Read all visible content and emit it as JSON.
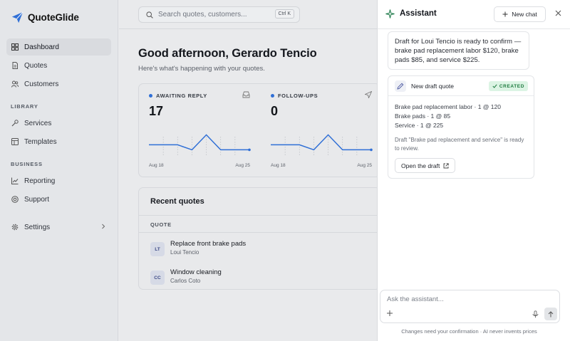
{
  "app": {
    "name": "QuoteGlide"
  },
  "sidebar": {
    "nav": [
      {
        "label": "Dashboard",
        "icon": "dashboard-icon",
        "active": true
      },
      {
        "label": "Quotes",
        "icon": "document-icon"
      },
      {
        "label": "Customers",
        "icon": "users-icon"
      }
    ],
    "library_label": "LIBRARY",
    "library": [
      {
        "label": "Services",
        "icon": "wrench-icon"
      },
      {
        "label": "Templates",
        "icon": "template-icon"
      }
    ],
    "business_label": "BUSINESS",
    "business": [
      {
        "label": "Reporting",
        "icon": "chart-icon"
      },
      {
        "label": "Support",
        "icon": "lifebuoy-icon"
      }
    ],
    "settings_label": "Settings"
  },
  "search": {
    "placeholder": "Search quotes, customers...",
    "shortcut": "Ctrl K"
  },
  "main": {
    "greeting": "Good afternoon, Gerardo Tencio",
    "subtitle": "Here's what's happening with your quotes.",
    "stats": [
      {
        "label": "AWAITING REPLY",
        "value": "17",
        "icon": "inbox-icon",
        "x_start": "Aug 18",
        "x_end": "Aug 25",
        "trend": [
          0.45,
          0.45,
          0.45,
          0.2,
          0.95,
          0.2,
          0.2,
          0.2
        ]
      },
      {
        "label": "FOLLOW-UPS",
        "value": "0",
        "icon": "send-icon",
        "x_start": "Aug 18",
        "x_end": "Aug 25",
        "trend": [
          0.45,
          0.45,
          0.45,
          0.2,
          0.95,
          0.2,
          0.2,
          0.2
        ]
      }
    ],
    "recent": {
      "title": "Recent quotes",
      "column": "QUOTE",
      "rows": [
        {
          "initials": "LT",
          "title": "Replace front brake pads",
          "customer": "Loui Tencio"
        },
        {
          "initials": "CC",
          "title": "Window cleaning",
          "customer": "Carlos Coto"
        }
      ]
    }
  },
  "assistant": {
    "title": "Assistant",
    "new_chat": "New chat",
    "message": "Draft for Loui Tencio is ready to confirm — brake pad replacement labor $120, brake pads $85, and service $225.",
    "tool": {
      "title": "New draft quote",
      "badge": "CREATED",
      "items": [
        "Brake pad replacement labor · 1 @ 120",
        "Brake pads · 1 @ 85",
        "Service · 1 @ 225"
      ],
      "note": "Draft \"Brake pad replacement and service\" is ready to review.",
      "open_label": "Open the draft"
    },
    "composer_placeholder": "Ask the assistant...",
    "footnote": "Changes need your confirmation · AI never invents prices"
  },
  "colors": {
    "accent": "#2f6fd6",
    "badge_bg": "#dcf4e4",
    "badge_fg": "#1d7a3e"
  }
}
